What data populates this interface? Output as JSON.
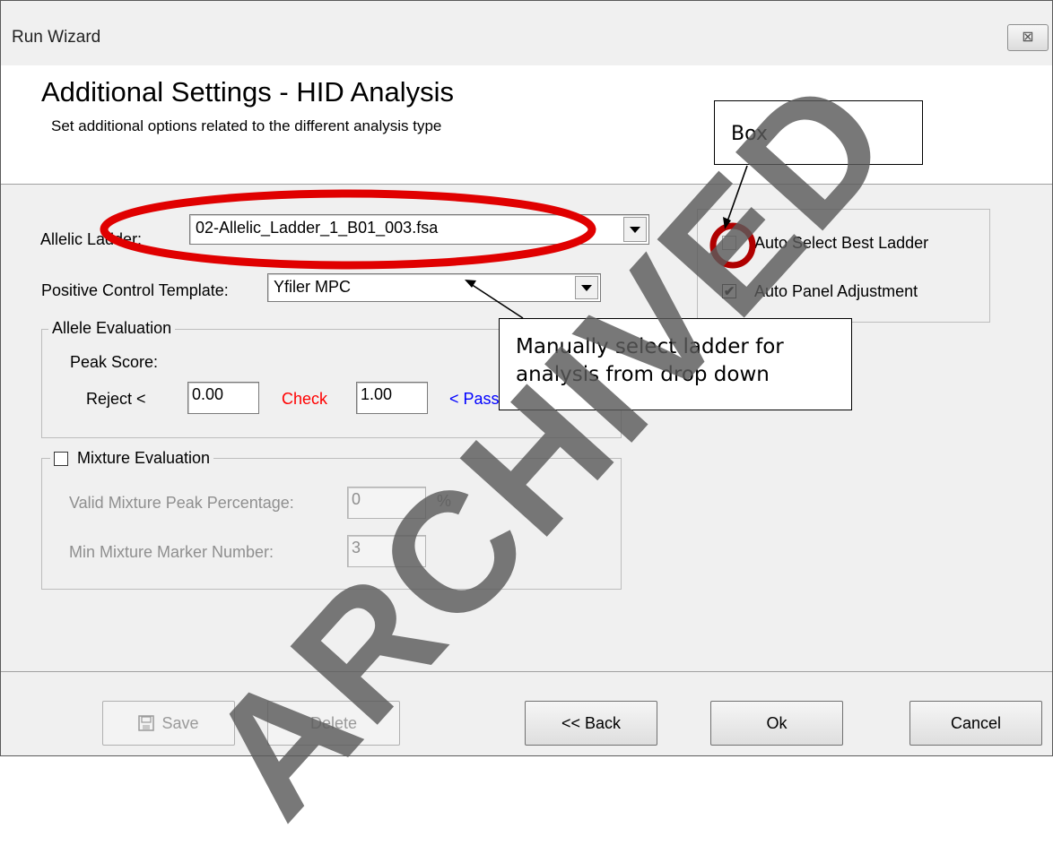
{
  "window": {
    "title": "Run Wizard",
    "close_glyph": "⊠"
  },
  "header": {
    "heading": "Additional Settings - HID Analysis",
    "subheading": "Set additional options related to the different analysis type"
  },
  "allelic_ladder": {
    "label": "Allelic Ladder:",
    "value": "02-Allelic_Ladder_1_B01_003.fsa"
  },
  "positive_control": {
    "label": "Positive Control Template:",
    "value": "Yfiler MPC"
  },
  "ladder_options": {
    "auto_select_label": "Auto Select Best Ladder",
    "auto_select_checked": false,
    "auto_panel_label": "Auto Panel Adjustment",
    "auto_panel_checked": true
  },
  "allele_evaluation": {
    "title": "Allele Evaluation",
    "peak_score_label": "Peak Score:",
    "reject_label": "Reject  <",
    "reject_value": "0.00",
    "check_label": "Check",
    "check_value": "1.00",
    "pass_label": "< Pass"
  },
  "mixture_evaluation": {
    "title": "Mixture Evaluation",
    "enabled": false,
    "valid_peak_label": "Valid Mixture Peak Percentage:",
    "valid_peak_value": "0",
    "percent_unit": "%",
    "min_marker_label": "Min Mixture Marker Number:",
    "min_marker_value": "3"
  },
  "buttons": {
    "save": "Save",
    "delete": "Delete",
    "back": "<< Back",
    "ok": "Ok",
    "cancel": "Cancel"
  },
  "annotations": {
    "box_callout": "Box",
    "manual_callout_line1": "Manually select ladder for",
    "manual_callout_line2": "analysis from drop down",
    "watermark": "ARCHIVED"
  },
  "colors": {
    "check_label": "#ff0000",
    "pass_label": "#0000ff",
    "annotation_ellipse": "#e00000",
    "annotation_circle": "#b00000",
    "watermark": "#5a5a5a"
  }
}
